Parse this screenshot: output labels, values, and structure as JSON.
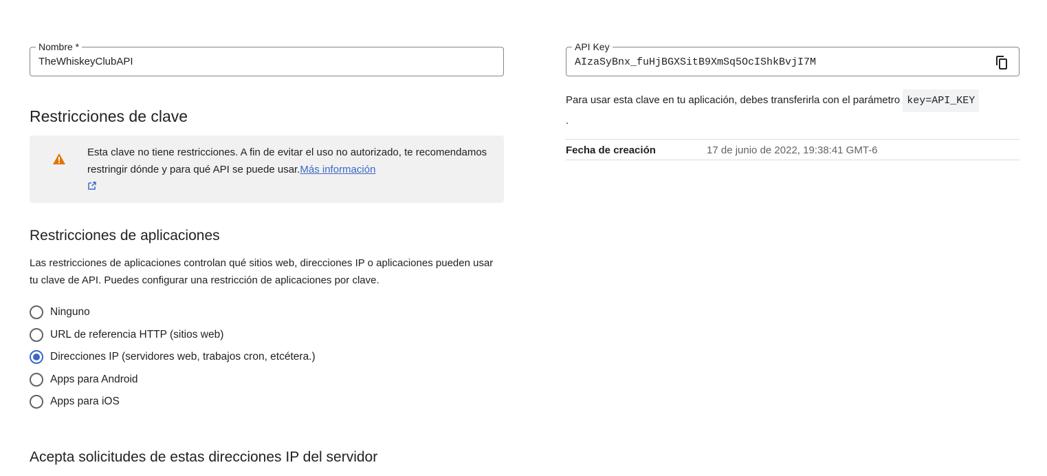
{
  "name_field": {
    "label": "Nombre *",
    "value": "TheWhiskeyClubAPI"
  },
  "key_restrictions": {
    "title": "Restricciones de clave",
    "warning_text": "Esta clave no tiene restricciones. A fin de evitar el uso no autorizado, te recomendamos restringir dónde y para qué API se puede usar.",
    "more_info_link": "Más información"
  },
  "app_restrictions": {
    "title": "Restricciones de aplicaciones",
    "description": "Las restricciones de aplicaciones controlan qué sitios web, direcciones IP o aplicaciones pueden usar tu clave de API. Puedes configurar una restricción de aplicaciones por clave.",
    "options": [
      {
        "label": "Ninguno",
        "selected": false
      },
      {
        "label": "URL de referencia HTTP (sitios web)",
        "selected": false
      },
      {
        "label": "Direcciones IP (servidores web, trabajos cron, etcétera.)",
        "selected": true
      },
      {
        "label": "Apps para Android",
        "selected": false
      },
      {
        "label": "Apps para iOS",
        "selected": false
      }
    ]
  },
  "ip_section": {
    "title": "Acepta solicitudes de estas direcciones IP del servidor"
  },
  "api_key": {
    "label": "API Key",
    "value": "AIzaSyBnx_fuHjBGXSitB9XmSq5OcIShkBvjI7M",
    "copy_icon": "copy-icon",
    "usage_text": "Para usar esta clave en tu aplicación, debes transferirla con el parámetro",
    "param": "key=API_KEY",
    "trailing": "."
  },
  "created": {
    "label": "Fecha de creación",
    "value": "17 de junio de 2022, 19:38:41 GMT-6"
  },
  "colors": {
    "accent": "#3c67c8",
    "warning": "#e37400",
    "banner_bg": "#f1f1f1"
  }
}
